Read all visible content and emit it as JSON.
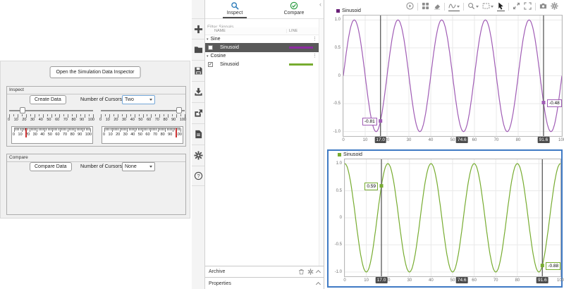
{
  "glyphs": {
    "caret_down": "▾",
    "dots_menu": "⋮",
    "collapse": "‹",
    "check": "✓",
    "help": "?"
  },
  "left_app": {
    "open_button": "Open the Simulation Data Inspector",
    "scale_labels": [
      "0",
      "10",
      "20",
      "30",
      "40",
      "50",
      "60",
      "70",
      "80",
      "90",
      "100"
    ],
    "inspect": {
      "title": "Inspect",
      "create_button": "Create Data",
      "cursors_label": "Number of Cursors",
      "cursors_value": "Two",
      "slider_values": [
        17,
        91.6
      ],
      "gauge_values": [
        17,
        91.6
      ]
    },
    "compare": {
      "title": "Compare",
      "compare_button": "Compare Data",
      "cursors_label": "Number of Cursors",
      "cursors_value": "None"
    }
  },
  "toolstrip": {
    "tools": [
      "new",
      "open",
      "save",
      "import",
      "export",
      "create-report",
      "preferences",
      "help"
    ]
  },
  "signal_panel": {
    "tabs": [
      {
        "label": "Inspect"
      },
      {
        "label": "Compare"
      }
    ],
    "filter_placeholder": "Filter Signals",
    "columns": {
      "name": "NAME",
      "line": "LINE"
    },
    "groups": [
      {
        "name": "Sine",
        "signals": [
          {
            "name": "Sinusoid",
            "checked": false,
            "selected": true,
            "line_color": "#8d2ba1"
          }
        ]
      },
      {
        "name": "Cosine",
        "signals": [
          {
            "name": "Sinusoid",
            "checked": true,
            "selected": false,
            "line_color": "#77ac30"
          }
        ]
      }
    ],
    "archive": {
      "label": "Archive"
    },
    "properties": {
      "label": "Properties"
    }
  },
  "plot_toolbar": {
    "tools": [
      "run",
      "subplot-layout",
      "clear-subplot",
      "data-cursors",
      "zoom",
      "fit-to-view",
      "pointer",
      "expand",
      "fullscreen",
      "snapshot",
      "settings"
    ]
  },
  "chart_data": [
    {
      "type": "line",
      "legend": [
        "Sinusoid"
      ],
      "series": [
        {
          "name": "Sinusoid",
          "waveform": "sine",
          "amplitude": 1,
          "period": 20,
          "color": "#a05cb5",
          "legend_color": "#6a2178"
        }
      ],
      "x_range": [
        0,
        100
      ],
      "ylim": [
        -1.08,
        1.08
      ],
      "grid": true,
      "xticks": [
        {
          "v": 0,
          "label": "0"
        },
        {
          "v": 10,
          "label": "10"
        },
        {
          "v": 20,
          "label": "20"
        },
        {
          "v": 30,
          "label": "30"
        },
        {
          "v": 40,
          "label": "40"
        },
        {
          "v": 50,
          "label": "50"
        },
        {
          "v": 60,
          "label": "60"
        },
        {
          "v": 70,
          "label": "70"
        },
        {
          "v": 80,
          "label": "80"
        },
        {
          "v": 90,
          "label": "90"
        },
        {
          "v": 100,
          "label": "100"
        }
      ],
      "yticks": [
        {
          "v": 1,
          "label": "1.0"
        },
        {
          "v": 0.5,
          "label": "0.5"
        },
        {
          "v": 0,
          "label": "0"
        },
        {
          "v": -0.5,
          "label": "-0.5"
        },
        {
          "v": -1,
          "label": "-1.0"
        }
      ],
      "cursors": [
        {
          "x": 17.0,
          "badge": "17.0",
          "value": -0.81,
          "value_label": "-0.81",
          "label_side": "left"
        },
        {
          "x": 91.6,
          "badge": "91.6",
          "value": -0.48,
          "value_label": "-0.48",
          "label_side": "right"
        }
      ],
      "cursor_delta": {
        "badge": "74.6",
        "x": 54.3
      },
      "selected": false
    },
    {
      "type": "line",
      "legend": [
        "Sinusoid"
      ],
      "series": [
        {
          "name": "Sinusoid",
          "waveform": "cosine",
          "amplitude": 1,
          "period": 20,
          "color": "#77ac30",
          "legend_color": "#77ac30"
        }
      ],
      "x_range": [
        0,
        100
      ],
      "ylim": [
        -1.08,
        1.08
      ],
      "grid": true,
      "xticks": [
        {
          "v": 0,
          "label": "0"
        },
        {
          "v": 10,
          "label": "10"
        },
        {
          "v": 20,
          "label": "20"
        },
        {
          "v": 30,
          "label": "30"
        },
        {
          "v": 40,
          "label": "40"
        },
        {
          "v": 50,
          "label": "50"
        },
        {
          "v": 60,
          "label": "60"
        },
        {
          "v": 70,
          "label": "70"
        },
        {
          "v": 80,
          "label": "80"
        },
        {
          "v": 90,
          "label": "90"
        },
        {
          "v": 100,
          "label": "100"
        }
      ],
      "yticks": [
        {
          "v": 1,
          "label": "1.0"
        },
        {
          "v": 0.5,
          "label": "0.5"
        },
        {
          "v": 0,
          "label": "0"
        },
        {
          "v": -0.5,
          "label": "-0.5"
        },
        {
          "v": -1,
          "label": "-1.0"
        }
      ],
      "cursors": [
        {
          "x": 17.0,
          "badge": "17.0",
          "value": 0.59,
          "value_label": "0.59",
          "label_side": "left"
        },
        {
          "x": 91.6,
          "badge": "91.6",
          "value": -0.88,
          "value_label": "-0.88",
          "label_side": "right"
        }
      ],
      "cursor_delta": {
        "badge": "74.6",
        "x": 54.3
      },
      "selected": true
    }
  ]
}
